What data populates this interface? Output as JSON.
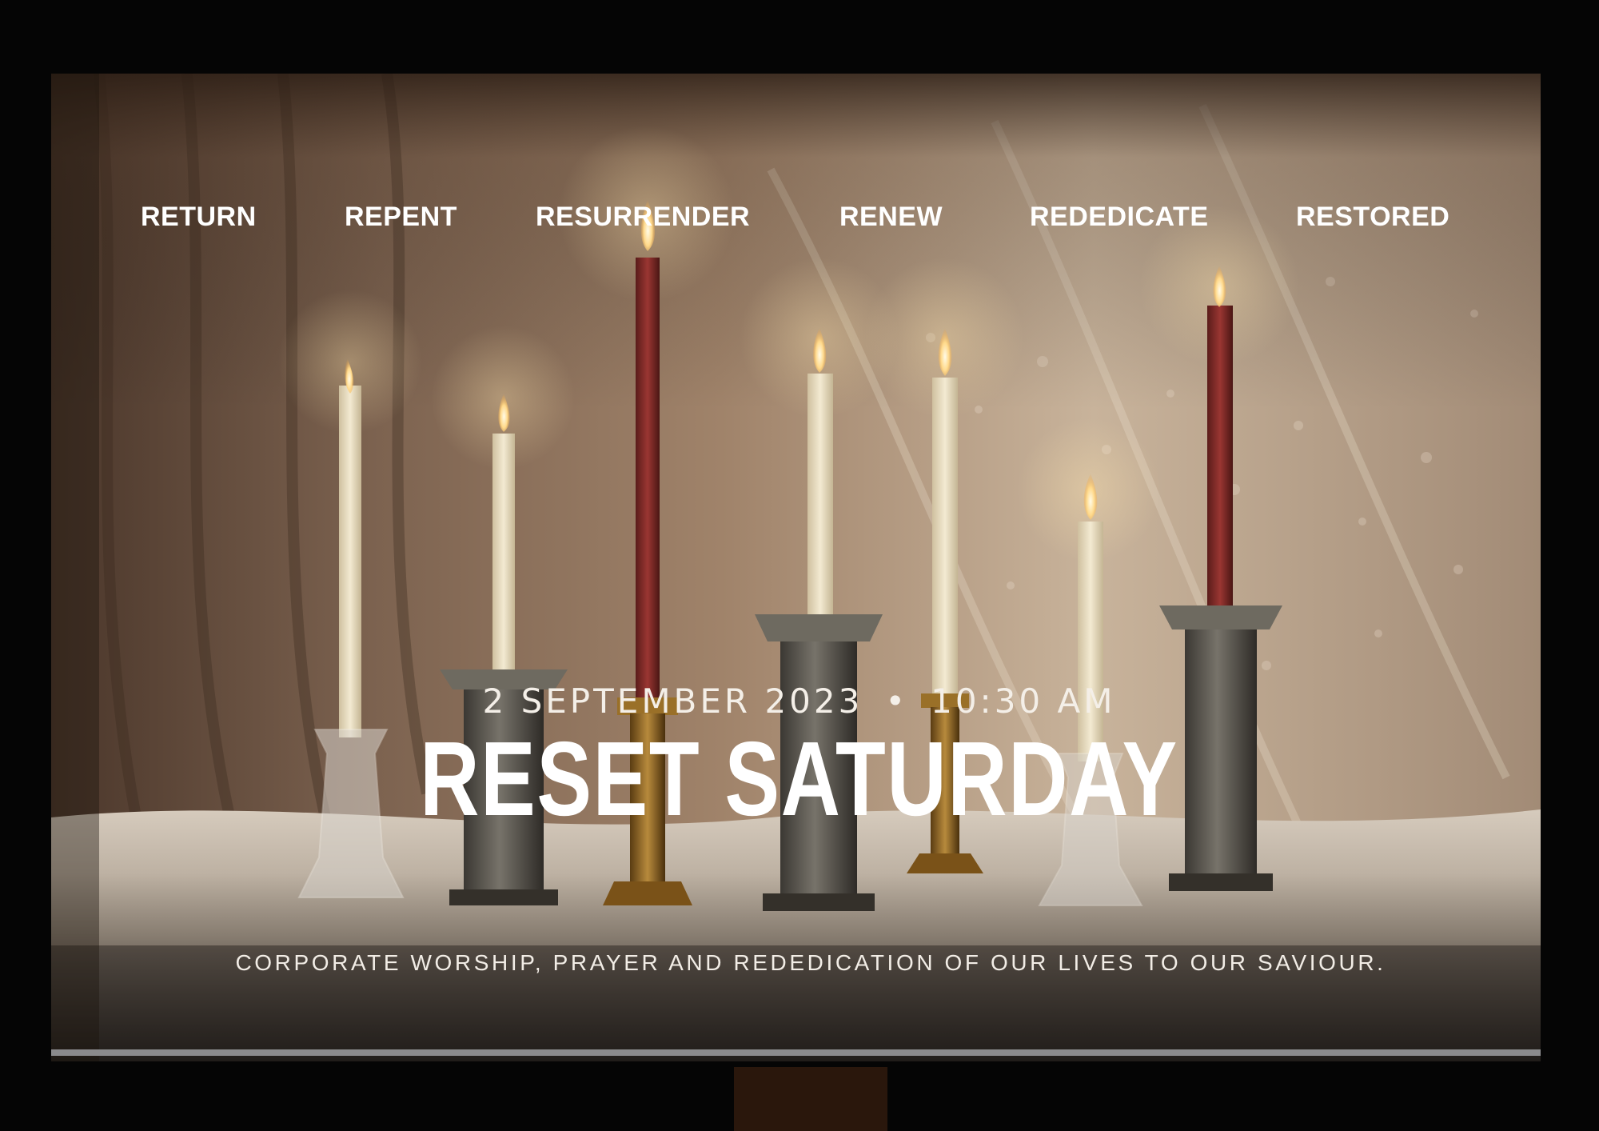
{
  "nav": {
    "items": [
      {
        "label": "RETURN"
      },
      {
        "label": "REPENT"
      },
      {
        "label": "RESURRENDER"
      },
      {
        "label": "RENEW"
      },
      {
        "label": "REDEDICATE"
      },
      {
        "label": "RESTORED"
      }
    ]
  },
  "event": {
    "date": "2 SEPTEMBER 2023",
    "separator": "•",
    "time": "10:30 AM",
    "title": "RESET SATURDAY",
    "tagline": "CORPORATE WORSHIP, PRAYER AND REDEDICATION OF OUR LIVES TO OUR SAVIOUR."
  },
  "colors": {
    "background": "#050505",
    "text": "#ffffff",
    "curtain": "#8a6a4e",
    "candle_ivory": "#efe4c8",
    "candle_red": "#8c2c2a"
  }
}
